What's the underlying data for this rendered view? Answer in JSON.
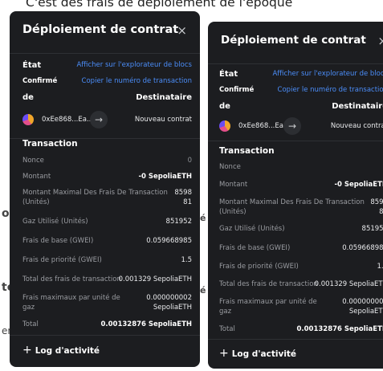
{
  "banner": {
    "text": "C'est des frais de déploiement de l'époque"
  },
  "background": {
    "frag1": "ok",
    "frag2": "té",
    "frag3": "en",
    "frag4": "é"
  },
  "panel": {
    "title": "Déploiement de contrat",
    "close_icon": "×",
    "status_label": "État",
    "explorer_link": "Afficher sur l'explorateur de blocs",
    "status_value": "Confirmé",
    "copy_tx_link": "Copier le numéro de transaction",
    "from_label": "de",
    "to_label": "Destinataire",
    "from_address": "0xEe868...Ea...",
    "arrow_icon": "→",
    "to_value": "Nouveau contrat",
    "transaction_heading": "Transaction",
    "rows": {
      "nonce": {
        "label": "Nonce",
        "value": "0"
      },
      "amount": {
        "label": "Montant",
        "value": "-0 SepoliaETH"
      },
      "max_fee": {
        "label1": "Montant Maximal Des Frais De Transaction",
        "label2": "(Unités)",
        "value1": "8598",
        "value2": "81"
      },
      "gas_used": {
        "label": "Gaz Utilisé (Unités)",
        "value": "851952"
      },
      "base_fee": {
        "label": "Frais de base (GWEI)",
        "value": "0.059668985"
      },
      "priority_fee": {
        "label": "Frais de priorité (GWEI)",
        "value": "1.5"
      },
      "total_fees": {
        "label": "Total des frais de transaction",
        "value": "0.001329 SepoliaETH"
      },
      "max_fee_per_gas": {
        "label1": "Frais maximaux par unité de",
        "label2": "gaz",
        "value1": "0.000000002",
        "value2": "SepoliaETH"
      },
      "total": {
        "label": "Total",
        "value": "0.00132876 SepoliaETH"
      }
    },
    "activity_log": "Log d'activité",
    "plus_icon": "+"
  },
  "colors": {
    "panel_bg": "#1c1d20",
    "link": "#4b8df8",
    "muted": "#9a9ca1"
  }
}
